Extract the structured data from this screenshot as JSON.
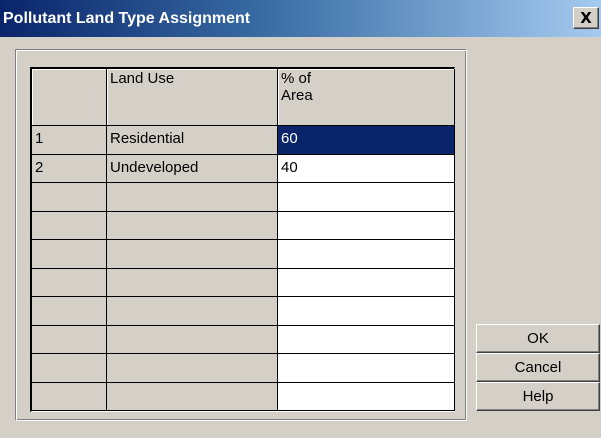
{
  "window": {
    "title": "Pollutant Land Type Assignment",
    "close_label": "X"
  },
  "grid": {
    "headers": {
      "row_number": "",
      "land_use": "Land Use",
      "percent_line1": "% of",
      "percent_line2": "Area"
    },
    "rows": [
      {
        "n": "1",
        "land_use": "Residential",
        "pct": "60",
        "selected": true
      },
      {
        "n": "2",
        "land_use": "Undeveloped",
        "pct": "40",
        "selected": false
      },
      {
        "n": "",
        "land_use": "",
        "pct": "",
        "selected": false
      },
      {
        "n": "",
        "land_use": "",
        "pct": "",
        "selected": false
      },
      {
        "n": "",
        "land_use": "",
        "pct": "",
        "selected": false
      },
      {
        "n": "",
        "land_use": "",
        "pct": "",
        "selected": false
      },
      {
        "n": "",
        "land_use": "",
        "pct": "",
        "selected": false
      },
      {
        "n": "",
        "land_use": "",
        "pct": "",
        "selected": false
      },
      {
        "n": "",
        "land_use": "",
        "pct": "",
        "selected": false
      },
      {
        "n": "",
        "land_use": "",
        "pct": "",
        "selected": false
      }
    ]
  },
  "buttons": {
    "ok": "OK",
    "cancel": "Cancel",
    "help": "Help"
  },
  "colors": {
    "selection": "#0a246a",
    "dialog_bg": "#d4d0c8",
    "title_start": "#0a246a",
    "title_end": "#a6caf0"
  }
}
